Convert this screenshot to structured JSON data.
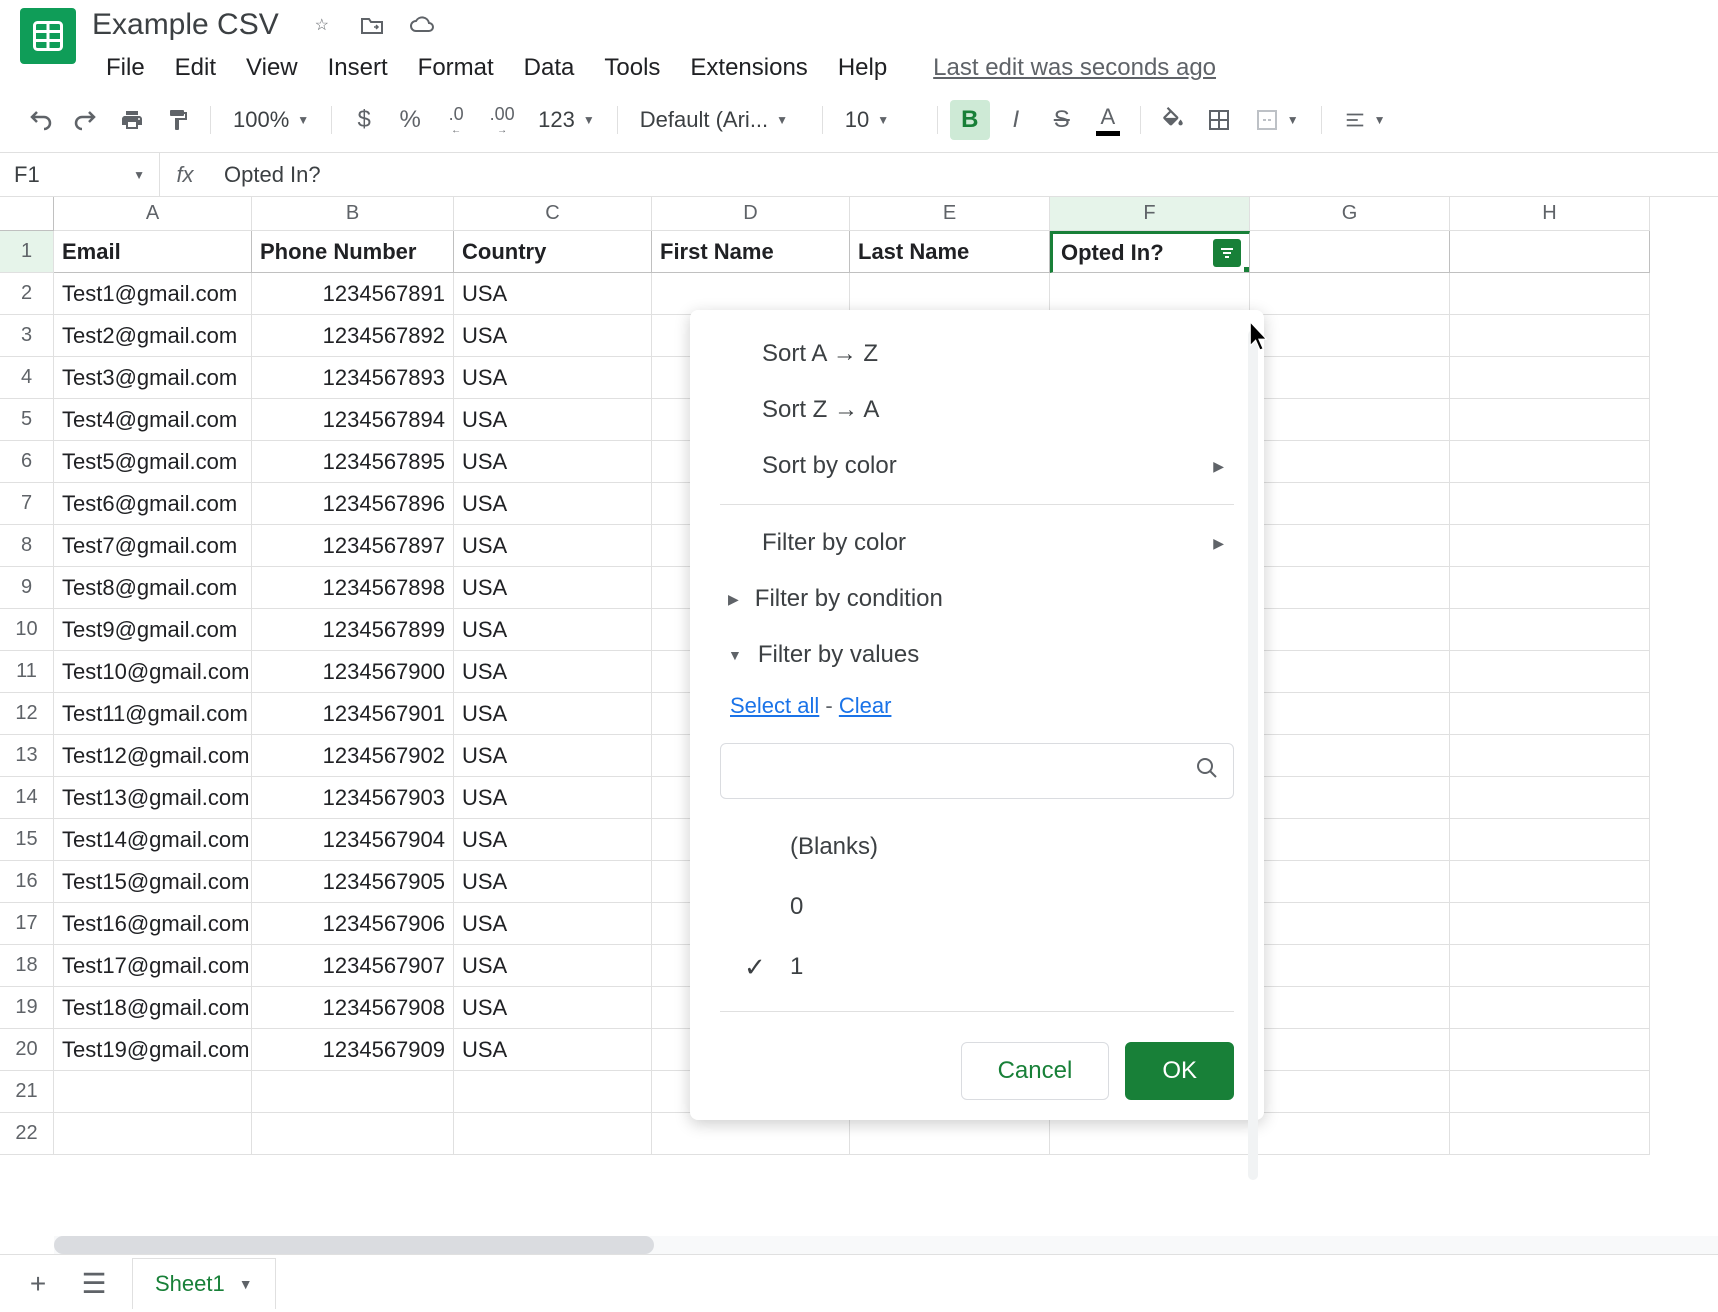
{
  "doc_title": "Example CSV",
  "menu": [
    "File",
    "Edit",
    "View",
    "Insert",
    "Format",
    "Data",
    "Tools",
    "Extensions",
    "Help"
  ],
  "last_edit": "Last edit was seconds ago",
  "toolbar": {
    "zoom": "100%",
    "currency": "$",
    "percent": "%",
    "dec_dec": ".0",
    "inc_dec": ".00",
    "more_formats": "123",
    "font": "Default (Ari...",
    "font_size": "10"
  },
  "cell_ref": "F1",
  "formula": "Opted In?",
  "columns": [
    "A",
    "B",
    "C",
    "D",
    "E",
    "F",
    "G",
    "H"
  ],
  "headers": [
    "Email",
    "Phone Number",
    "Country",
    "First Name",
    "Last Name",
    "Opted In?"
  ],
  "rows": [
    {
      "email": "Test1@gmail.com",
      "phone": "1234567891",
      "country": "USA"
    },
    {
      "email": "Test2@gmail.com",
      "phone": "1234567892",
      "country": "USA"
    },
    {
      "email": "Test3@gmail.com",
      "phone": "1234567893",
      "country": "USA"
    },
    {
      "email": "Test4@gmail.com",
      "phone": "1234567894",
      "country": "USA"
    },
    {
      "email": "Test5@gmail.com",
      "phone": "1234567895",
      "country": "USA"
    },
    {
      "email": "Test6@gmail.com",
      "phone": "1234567896",
      "country": "USA"
    },
    {
      "email": "Test7@gmail.com",
      "phone": "1234567897",
      "country": "USA"
    },
    {
      "email": "Test8@gmail.com",
      "phone": "1234567898",
      "country": "USA"
    },
    {
      "email": "Test9@gmail.com",
      "phone": "1234567899",
      "country": "USA"
    },
    {
      "email": "Test10@gmail.com",
      "phone": "1234567900",
      "country": "USA"
    },
    {
      "email": "Test11@gmail.com",
      "phone": "1234567901",
      "country": "USA"
    },
    {
      "email": "Test12@gmail.com",
      "phone": "1234567902",
      "country": "USA"
    },
    {
      "email": "Test13@gmail.com",
      "phone": "1234567903",
      "country": "USA"
    },
    {
      "email": "Test14@gmail.com",
      "phone": "1234567904",
      "country": "USA"
    },
    {
      "email": "Test15@gmail.com",
      "phone": "1234567905",
      "country": "USA"
    },
    {
      "email": "Test16@gmail.com",
      "phone": "1234567906",
      "country": "USA"
    },
    {
      "email": "Test17@gmail.com",
      "phone": "1234567907",
      "country": "USA"
    },
    {
      "email": "Test18@gmail.com",
      "phone": "1234567908",
      "country": "USA"
    },
    {
      "email": "Test19@gmail.com",
      "phone": "1234567909",
      "country": "USA"
    }
  ],
  "filter_menu": {
    "sort_az": "Sort A → Z",
    "sort_za": "Sort Z → A",
    "sort_color": "Sort by color",
    "filter_color": "Filter by color",
    "filter_condition": "Filter by condition",
    "filter_values": "Filter by values",
    "select_all": "Select all",
    "clear": "Clear",
    "values": [
      {
        "label": "(Blanks)",
        "checked": false
      },
      {
        "label": "0",
        "checked": false
      },
      {
        "label": "1",
        "checked": true
      }
    ],
    "cancel": "Cancel",
    "ok": "OK"
  },
  "sheet_tab": "Sheet1"
}
